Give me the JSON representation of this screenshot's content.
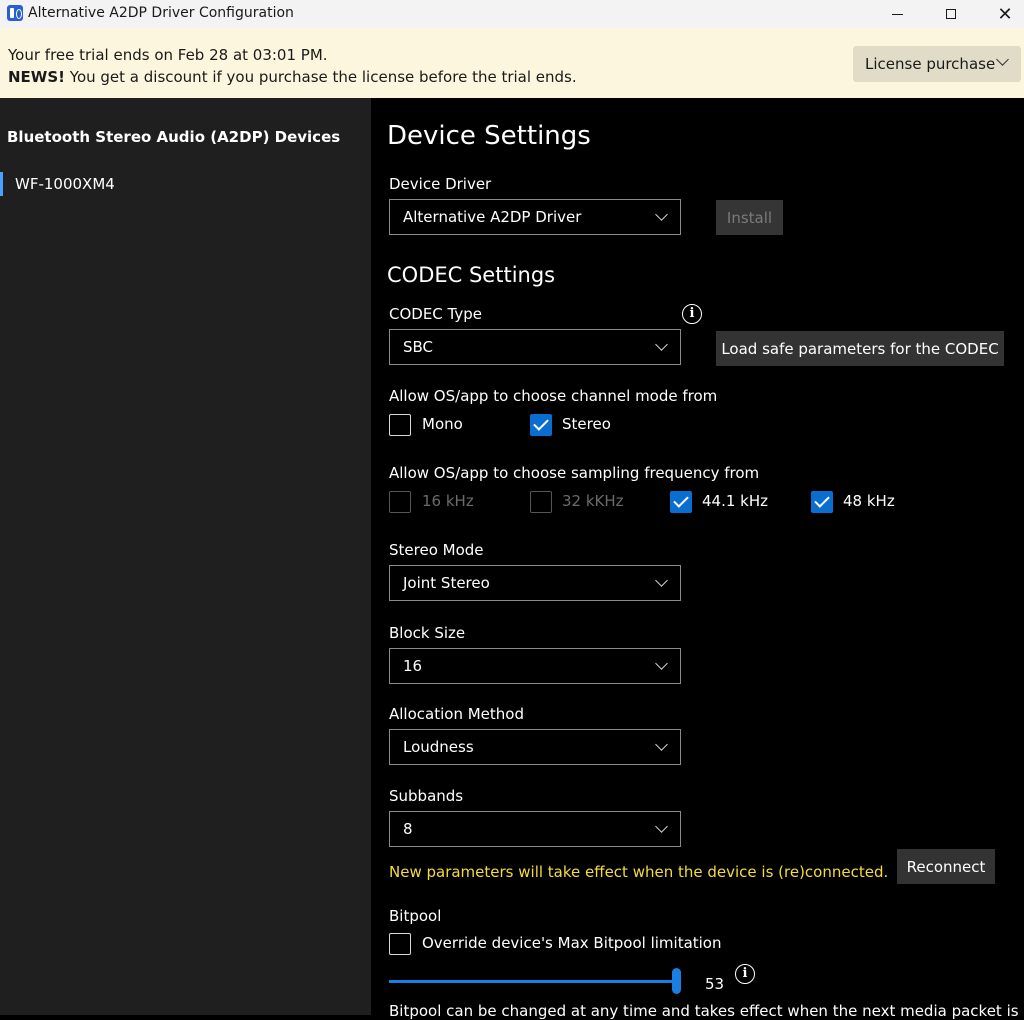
{
  "window": {
    "title": "Alternative A2DP Driver Configuration",
    "icon": "bluetooth-app-icon"
  },
  "banner": {
    "line1": "Your free trial ends on Feb 28 at 03:01 PM.",
    "news_prefix": "NEWS!",
    "news_text": " You get a discount if you purchase the license before the trial ends.",
    "license_button": "License purchase"
  },
  "sidebar": {
    "title": "Bluetooth Stereo Audio (A2DP) Devices",
    "devices": [
      {
        "label": "WF-1000XM4",
        "selected": true
      }
    ]
  },
  "main": {
    "title": "Device Settings",
    "driver": {
      "label": "Device Driver",
      "value": "Alternative A2DP Driver",
      "install_button": "Install"
    },
    "codec_title": "CODEC Settings",
    "codec": {
      "label": "CODEC Type",
      "value": "SBC",
      "load_button": "Load safe parameters for the CODEC"
    },
    "channel_mode": {
      "label": "Allow OS/app to choose channel mode from",
      "options": [
        {
          "label": "Mono",
          "checked": false
        },
        {
          "label": "Stereo",
          "checked": true
        }
      ]
    },
    "sampling": {
      "label": "Allow OS/app to choose sampling frequency from",
      "options": [
        {
          "label": "16 kHz",
          "checked": false,
          "disabled": true
        },
        {
          "label": "32 kKHz",
          "checked": false,
          "disabled": true
        },
        {
          "label": "44.1 kHz",
          "checked": true,
          "disabled": false
        },
        {
          "label": "48 kHz",
          "checked": true,
          "disabled": false
        }
      ]
    },
    "stereo_mode": {
      "label": "Stereo Mode",
      "value": "Joint Stereo"
    },
    "block_size": {
      "label": "Block Size",
      "value": "16"
    },
    "allocation": {
      "label": "Allocation Method",
      "value": "Loudness"
    },
    "subbands": {
      "label": "Subbands",
      "value": "8"
    },
    "notice": "New parameters will take effect when the device is (re)connected.",
    "reconnect_button": "Reconnect",
    "bitpool": {
      "label": "Bitpool",
      "override_label": "Override device's Max Bitpool limitation",
      "override_checked": false,
      "value": "53",
      "level_fraction": 1.0
    },
    "footer": "Bitpool can be changed at any time and takes effect when the next media packet is"
  },
  "colors": {
    "accent": "#0a6ed1",
    "banner_bg": "#fdf6df",
    "notice": "#f5dc38"
  }
}
